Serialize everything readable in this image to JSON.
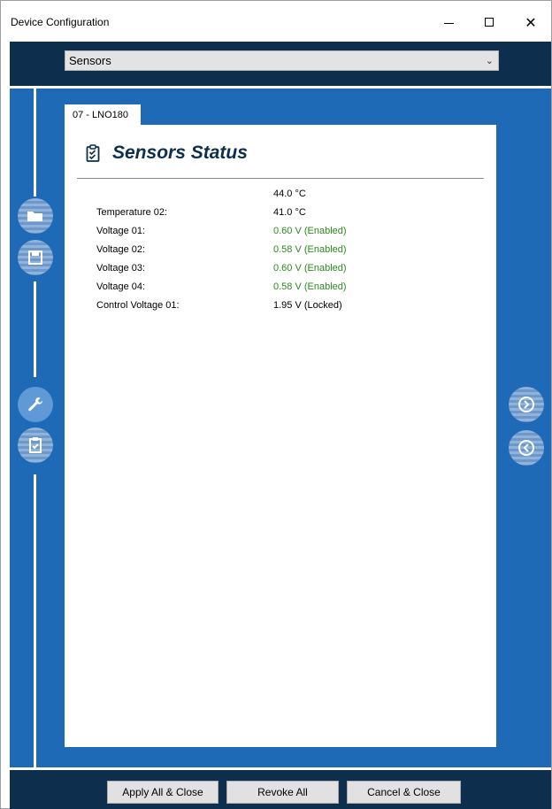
{
  "window": {
    "title": "Device Configuration",
    "minimize_glyph": "",
    "maximize_glyph": "",
    "close_glyph": "✕"
  },
  "selector": {
    "value": "Sensors",
    "chevron": "⌄"
  },
  "tab": {
    "label": "07 - LNO180"
  },
  "panel": {
    "title": "Sensors Status",
    "icon": "clipboard-check-icon"
  },
  "sensors": [
    {
      "label": "",
      "value": "44.0 °C",
      "state": "normal"
    },
    {
      "label": "Temperature 02:",
      "value": "41.0 °C",
      "state": "normal"
    },
    {
      "label": "Voltage 01:",
      "value": "0.60 V (Enabled)",
      "state": "enabled"
    },
    {
      "label": "Voltage 02:",
      "value": "0.58 V (Enabled)",
      "state": "enabled"
    },
    {
      "label": "Voltage 03:",
      "value": "0.60 V (Enabled)",
      "state": "enabled"
    },
    {
      "label": "Voltage 04:",
      "value": "0.58 V (Enabled)",
      "state": "enabled"
    },
    {
      "label": "Control Voltage 01:",
      "value": "1.95 V (Locked)",
      "state": "normal"
    }
  ],
  "side_nav": {
    "left": [
      {
        "name": "folder-icon",
        "state": "inactive"
      },
      {
        "name": "save-icon",
        "state": "inactive"
      },
      {
        "name": "wrench-icon",
        "state": "active"
      },
      {
        "name": "clipboard-icon",
        "state": "inactive"
      }
    ],
    "right": [
      {
        "name": "next-icon",
        "state": "inactive"
      },
      {
        "name": "previous-icon",
        "state": "inactive"
      }
    ]
  },
  "footer": {
    "apply_label": "Apply All & Close",
    "revoke_label": "Revoke All",
    "cancel_label": "Cancel & Close"
  },
  "colors": {
    "navy": "#0d2e4c",
    "blue": "#1e6ab7",
    "enabled_green": "#2a8a1e"
  }
}
